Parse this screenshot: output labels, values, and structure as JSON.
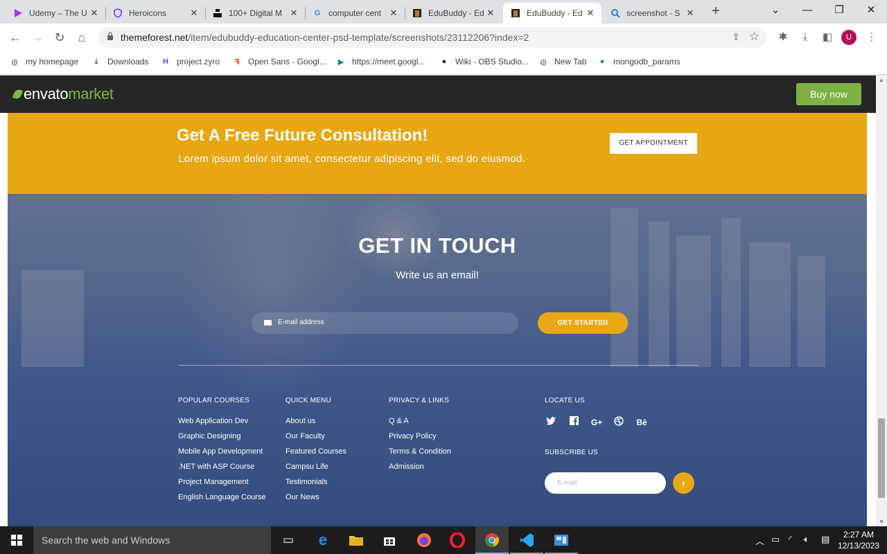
{
  "browser": {
    "tabs": [
      {
        "title": "Udemy – The U",
        "icon": "udemy-icon",
        "color": "#a435f0"
      },
      {
        "title": "Heroicons",
        "icon": "heroicons-shield-icon",
        "color": "#7c3aed"
      },
      {
        "title": "100+ Digital M",
        "icon": "unsplash-icon",
        "color": "#111111"
      },
      {
        "title": "computer cent",
        "icon": "google-icon",
        "color": "#4285f4"
      },
      {
        "title": "EduBuddy - Ed",
        "icon": "edubuddy-icon",
        "color": "#8b5a2b"
      },
      {
        "title": "EduBuddy - Ed",
        "icon": "edubuddy-icon",
        "color": "#8b5a2b"
      },
      {
        "title": "screenshot - S",
        "icon": "search-icon",
        "color": "#1a73e8"
      }
    ],
    "active_tab": 5,
    "url_domain": "themeforest.net",
    "url_path": "/item/edubuddy-education-center-psd-template/screenshots/23112206?index=2",
    "profile_letter": "U",
    "bookmarks": [
      {
        "label": "my homepage",
        "icon": "globe-icon"
      },
      {
        "label": "Downloads",
        "icon": "download-icon"
      },
      {
        "label": "project zyro",
        "icon": "zyro-icon"
      },
      {
        "label": "Open Sans - Googl...",
        "icon": "google-fonts-icon"
      },
      {
        "label": "https://meet.googl...",
        "icon": "google-meet-icon"
      },
      {
        "label": "Wiki - OBS Studio...",
        "icon": "obs-icon"
      },
      {
        "label": "New Tab",
        "icon": "globe-icon"
      },
      {
        "label": "mongodb_params",
        "icon": "mongodb-icon"
      }
    ]
  },
  "envato": {
    "logo_envato": "envato",
    "logo_market": "market",
    "buy_label": "Buy now",
    "brand_color": "#82b541"
  },
  "cta": {
    "title": "Get A Free Future Consultation!",
    "subtitle": "Lorem ipsum dolor sit amet, consectetur adipiscing  elit, sed do eiusmod.",
    "button": "GET APPOINTMENT",
    "band_color": "#e7a712"
  },
  "contact": {
    "title": "GET IN TOUCH",
    "subtitle": "Write us an email!",
    "email_placeholder": "E-mail address",
    "button": "GET STARTED"
  },
  "footer": {
    "popular_courses": {
      "heading": "POPULAR COURSES",
      "items": [
        "Web Application Dev",
        "Graphic Designing",
        "Mobile App Development",
        ".NET with ASP Course",
        "Project Management",
        "English Language Course"
      ]
    },
    "quick_menu": {
      "heading": "QUICK MENU",
      "items": [
        "About us",
        "Our Faculty",
        "Featured Courses",
        "Campsu Life",
        "Testimonials",
        "Our News"
      ]
    },
    "privacy": {
      "heading": "PRIVACY & LINKS",
      "items": [
        "Q & A",
        "Privacy Policy",
        "Terms & Condition",
        "Admission"
      ]
    },
    "locate": {
      "heading": "LOCATE US",
      "social": [
        {
          "name": "twitter-icon",
          "glyph": "t"
        },
        {
          "name": "facebook-icon",
          "glyph": "f"
        },
        {
          "name": "google-plus-icon",
          "glyph": "G+"
        },
        {
          "name": "dribbble-icon",
          "glyph": "◎"
        },
        {
          "name": "behance-icon",
          "glyph": "Bē"
        }
      ]
    },
    "subscribe": {
      "heading": "SUBSCRIBE US",
      "placeholder": "E-mail",
      "button": "›"
    }
  },
  "taskbar": {
    "search_placeholder": "Search the web and Windows",
    "time": "2:27 AM",
    "date": "12/13/2023"
  }
}
